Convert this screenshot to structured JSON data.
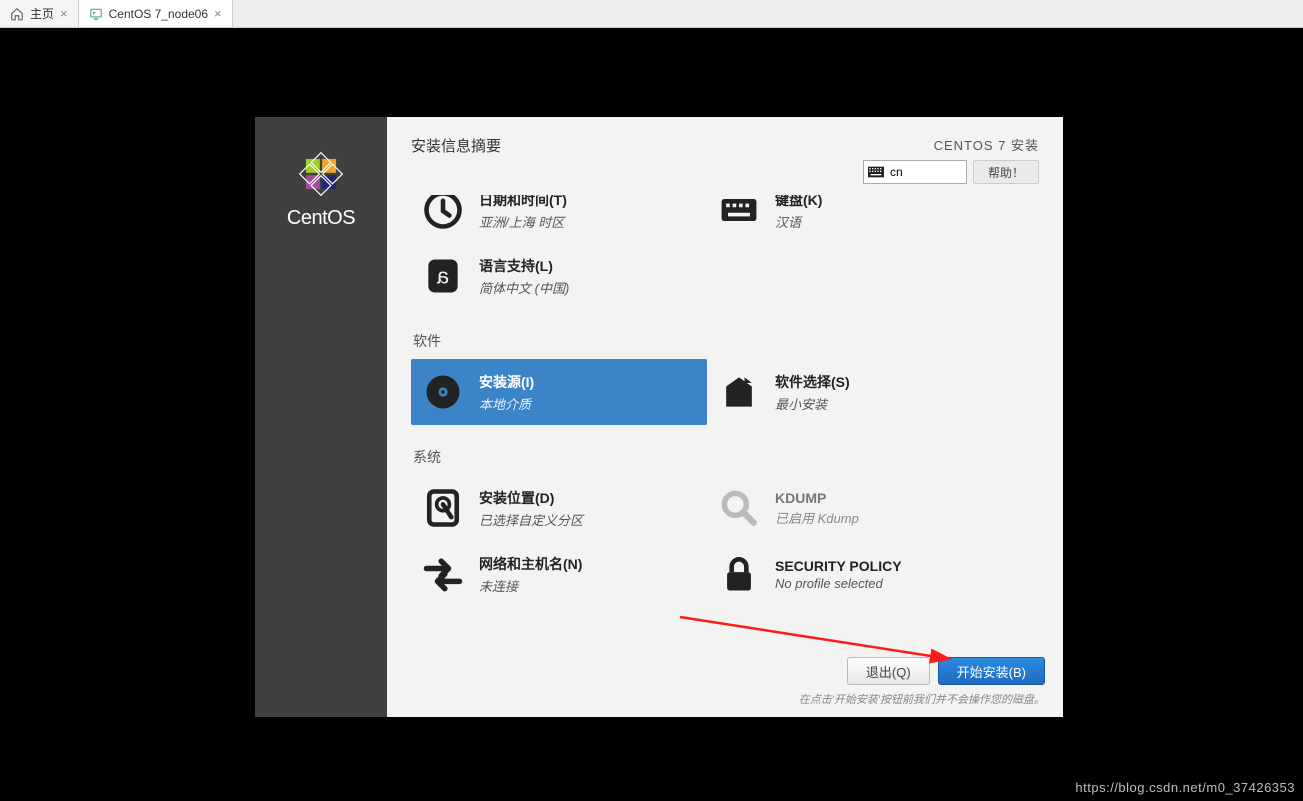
{
  "tabs": {
    "home": "主页",
    "vm": "CentOS 7_node06"
  },
  "header": {
    "title": "安装信息摘要",
    "product": "CENTOS 7 安装",
    "lang_short": "cn",
    "help": "帮助！"
  },
  "localization": {
    "datetime": {
      "title": "日期和时间(T)",
      "sub": "亚洲/上海 时区"
    },
    "keyboard": {
      "title": "键盘(K)",
      "sub": "汉语"
    },
    "language": {
      "title": "语言支持(L)",
      "sub": "简体中文 (中国)"
    }
  },
  "software": {
    "section": "软件",
    "source": {
      "title": "安装源(I)",
      "sub": "本地介质"
    },
    "selection": {
      "title": "软件选择(S)",
      "sub": "最小安装"
    }
  },
  "system": {
    "section": "系统",
    "dest": {
      "title": "安装位置(D)",
      "sub": "已选择自定义分区"
    },
    "kdump": {
      "title": "KDUMP",
      "sub": "已启用 Kdump"
    },
    "network": {
      "title": "网络和主机名(N)",
      "sub": "未连接"
    },
    "secpol": {
      "title": "SECURITY POLICY",
      "sub": "No profile selected"
    }
  },
  "footer": {
    "quit": "退出(Q)",
    "begin": "开始安装(B)",
    "hint": "在点击'开始安装'按钮前我们并不会操作您的磁盘。"
  },
  "watermark": "https://blog.csdn.net/m0_37426353"
}
